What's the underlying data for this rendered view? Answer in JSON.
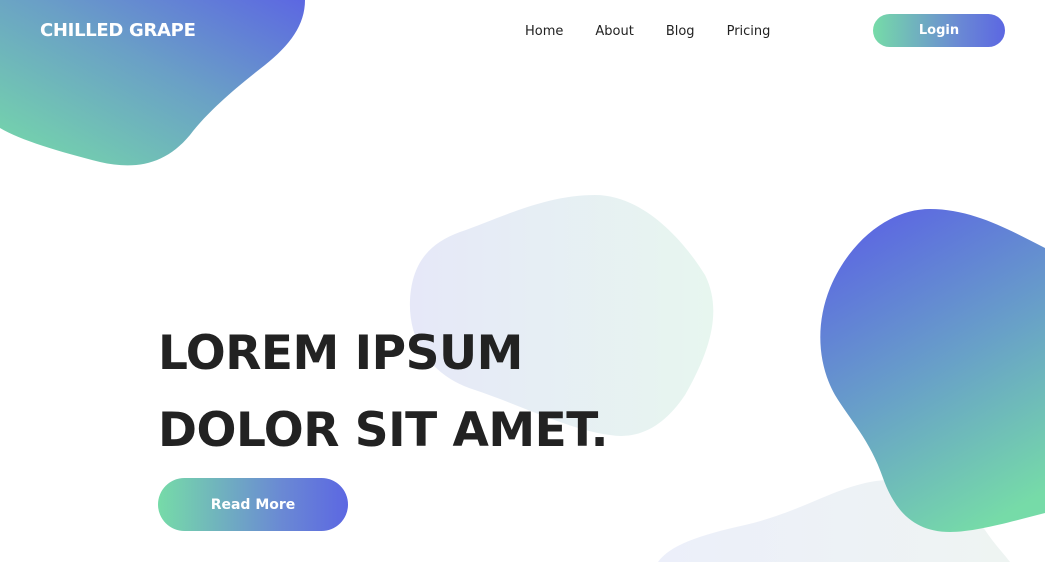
{
  "brand": {
    "logo_text": "CHILLED GRAPE"
  },
  "nav": {
    "items": [
      {
        "label": "Home"
      },
      {
        "label": "About"
      },
      {
        "label": "Blog"
      },
      {
        "label": "Pricing"
      }
    ],
    "login_label": "Login"
  },
  "hero": {
    "title_line1": "LOREM IPSUM",
    "title_line2": "DOLOR SIT AMET.",
    "button_label": "Read More"
  },
  "colors": {
    "gradient_green": "#76dba8",
    "gradient_blue": "#5c67e2",
    "text_dark": "#222222",
    "soft_blob_start": "#e6e8f8",
    "soft_blob_end": "#e7f6ef",
    "background": "#ffffff"
  }
}
